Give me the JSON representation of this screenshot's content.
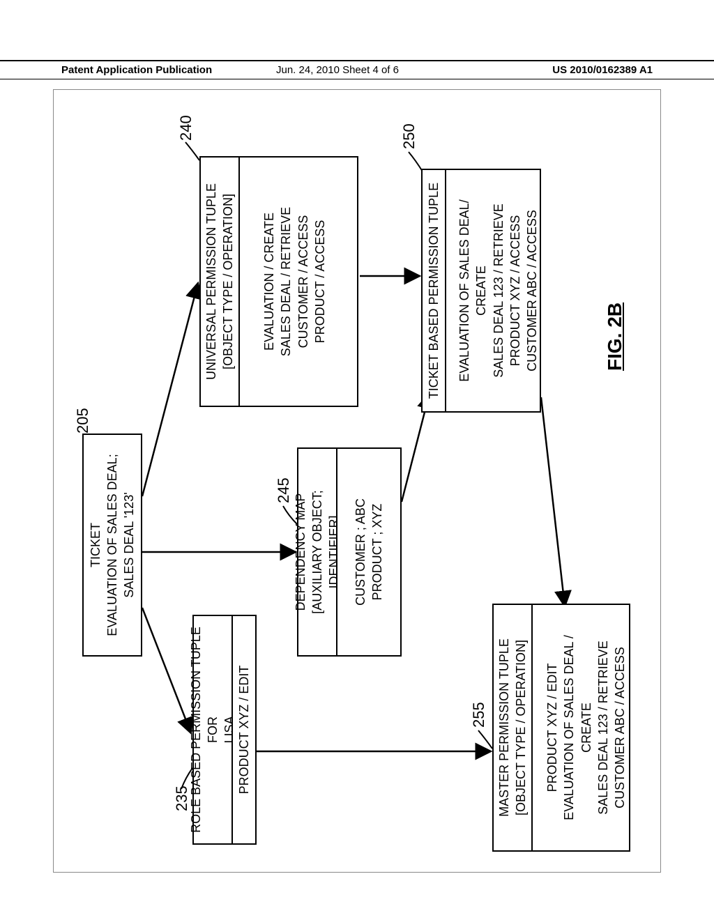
{
  "header": {
    "left": "Patent Application Publication",
    "center": "Jun. 24, 2010  Sheet 4 of 6",
    "right": "US 2010/0162389 A1"
  },
  "refs": {
    "r205": "205",
    "r235": "235",
    "r240": "240",
    "r245": "245",
    "r250": "250",
    "r255": "255"
  },
  "boxes": {
    "ticket_title": "TICKET",
    "ticket_body_l1": "EVALUATION OF SALES DEAL;",
    "ticket_body_l2": "SALES DEAL '123'",
    "rolebased_title_l1": "ROLE BASED PERMISSION TUPLE FOR",
    "rolebased_title_l2": "LISA",
    "rolebased_content": "PRODUCT XYZ / EDIT",
    "univ_title_l1": "UNIVERSAL PERMISSION TUPLE",
    "univ_title_l2": "[OBJECT TYPE / OPERATION]",
    "univ_content_l1": "EVALUATION / CREATE",
    "univ_content_l2": "SALES DEAL / RETRIEVE",
    "univ_content_l3": "CUSTOMER / ACCESS",
    "univ_content_l4": "PRODUCT / ACCESS",
    "dep_title_l1": "DEPENDENCY MAP",
    "dep_title_l2": "[AUXILIARY OBJECT; IDENTIFIER]",
    "dep_content_l1": "CUSTOMER ; ABC",
    "dep_content_l2": "PRODUCT ; XYZ",
    "tbt_title": "TICKET BASED PERMISSION TUPLE",
    "tbt_content_l1": "EVALUATION OF SALES DEAL/ CREATE",
    "tbt_content_l2": "SALES DEAL 123 / RETRIEVE",
    "tbt_content_l3": "PRODUCT XYZ / ACCESS",
    "tbt_content_l4": "CUSTOMER ABC / ACCESS",
    "master_title_l1": "MASTER PERMISSION TUPLE",
    "master_title_l2": "[OBJECT TYPE / OPERATION]",
    "master_content_l1": "PRODUCT XYZ / EDIT",
    "master_content_l2": "EVALUATION OF SALES DEAL / CREATE",
    "master_content_l3": "SALES DEAL 123 / RETRIEVE",
    "master_content_l4": "CUSTOMER ABC / ACCESS"
  },
  "figure_label": "FIG. 2B"
}
